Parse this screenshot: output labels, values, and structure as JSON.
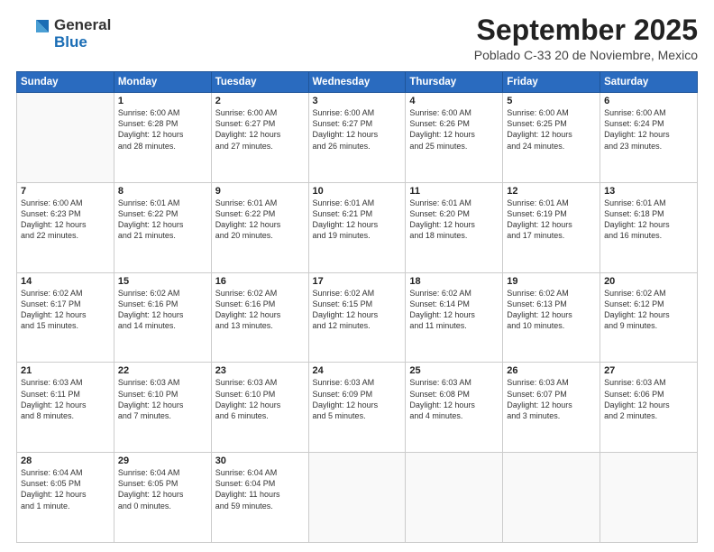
{
  "header": {
    "logo": {
      "line1": "General",
      "line2": "Blue"
    },
    "title": "September 2025",
    "location": "Poblado C-33 20 de Noviembre, Mexico"
  },
  "calendar": {
    "days_of_week": [
      "Sunday",
      "Monday",
      "Tuesday",
      "Wednesday",
      "Thursday",
      "Friday",
      "Saturday"
    ],
    "weeks": [
      [
        {
          "day": "",
          "info": ""
        },
        {
          "day": "1",
          "info": "Sunrise: 6:00 AM\nSunset: 6:28 PM\nDaylight: 12 hours\nand 28 minutes."
        },
        {
          "day": "2",
          "info": "Sunrise: 6:00 AM\nSunset: 6:27 PM\nDaylight: 12 hours\nand 27 minutes."
        },
        {
          "day": "3",
          "info": "Sunrise: 6:00 AM\nSunset: 6:27 PM\nDaylight: 12 hours\nand 26 minutes."
        },
        {
          "day": "4",
          "info": "Sunrise: 6:00 AM\nSunset: 6:26 PM\nDaylight: 12 hours\nand 25 minutes."
        },
        {
          "day": "5",
          "info": "Sunrise: 6:00 AM\nSunset: 6:25 PM\nDaylight: 12 hours\nand 24 minutes."
        },
        {
          "day": "6",
          "info": "Sunrise: 6:00 AM\nSunset: 6:24 PM\nDaylight: 12 hours\nand 23 minutes."
        }
      ],
      [
        {
          "day": "7",
          "info": "Sunrise: 6:00 AM\nSunset: 6:23 PM\nDaylight: 12 hours\nand 22 minutes."
        },
        {
          "day": "8",
          "info": "Sunrise: 6:01 AM\nSunset: 6:22 PM\nDaylight: 12 hours\nand 21 minutes."
        },
        {
          "day": "9",
          "info": "Sunrise: 6:01 AM\nSunset: 6:22 PM\nDaylight: 12 hours\nand 20 minutes."
        },
        {
          "day": "10",
          "info": "Sunrise: 6:01 AM\nSunset: 6:21 PM\nDaylight: 12 hours\nand 19 minutes."
        },
        {
          "day": "11",
          "info": "Sunrise: 6:01 AM\nSunset: 6:20 PM\nDaylight: 12 hours\nand 18 minutes."
        },
        {
          "day": "12",
          "info": "Sunrise: 6:01 AM\nSunset: 6:19 PM\nDaylight: 12 hours\nand 17 minutes."
        },
        {
          "day": "13",
          "info": "Sunrise: 6:01 AM\nSunset: 6:18 PM\nDaylight: 12 hours\nand 16 minutes."
        }
      ],
      [
        {
          "day": "14",
          "info": "Sunrise: 6:02 AM\nSunset: 6:17 PM\nDaylight: 12 hours\nand 15 minutes."
        },
        {
          "day": "15",
          "info": "Sunrise: 6:02 AM\nSunset: 6:16 PM\nDaylight: 12 hours\nand 14 minutes."
        },
        {
          "day": "16",
          "info": "Sunrise: 6:02 AM\nSunset: 6:16 PM\nDaylight: 12 hours\nand 13 minutes."
        },
        {
          "day": "17",
          "info": "Sunrise: 6:02 AM\nSunset: 6:15 PM\nDaylight: 12 hours\nand 12 minutes."
        },
        {
          "day": "18",
          "info": "Sunrise: 6:02 AM\nSunset: 6:14 PM\nDaylight: 12 hours\nand 11 minutes."
        },
        {
          "day": "19",
          "info": "Sunrise: 6:02 AM\nSunset: 6:13 PM\nDaylight: 12 hours\nand 10 minutes."
        },
        {
          "day": "20",
          "info": "Sunrise: 6:02 AM\nSunset: 6:12 PM\nDaylight: 12 hours\nand 9 minutes."
        }
      ],
      [
        {
          "day": "21",
          "info": "Sunrise: 6:03 AM\nSunset: 6:11 PM\nDaylight: 12 hours\nand 8 minutes."
        },
        {
          "day": "22",
          "info": "Sunrise: 6:03 AM\nSunset: 6:10 PM\nDaylight: 12 hours\nand 7 minutes."
        },
        {
          "day": "23",
          "info": "Sunrise: 6:03 AM\nSunset: 6:10 PM\nDaylight: 12 hours\nand 6 minutes."
        },
        {
          "day": "24",
          "info": "Sunrise: 6:03 AM\nSunset: 6:09 PM\nDaylight: 12 hours\nand 5 minutes."
        },
        {
          "day": "25",
          "info": "Sunrise: 6:03 AM\nSunset: 6:08 PM\nDaylight: 12 hours\nand 4 minutes."
        },
        {
          "day": "26",
          "info": "Sunrise: 6:03 AM\nSunset: 6:07 PM\nDaylight: 12 hours\nand 3 minutes."
        },
        {
          "day": "27",
          "info": "Sunrise: 6:03 AM\nSunset: 6:06 PM\nDaylight: 12 hours\nand 2 minutes."
        }
      ],
      [
        {
          "day": "28",
          "info": "Sunrise: 6:04 AM\nSunset: 6:05 PM\nDaylight: 12 hours\nand 1 minute."
        },
        {
          "day": "29",
          "info": "Sunrise: 6:04 AM\nSunset: 6:05 PM\nDaylight: 12 hours\nand 0 minutes."
        },
        {
          "day": "30",
          "info": "Sunrise: 6:04 AM\nSunset: 6:04 PM\nDaylight: 11 hours\nand 59 minutes."
        },
        {
          "day": "",
          "info": ""
        },
        {
          "day": "",
          "info": ""
        },
        {
          "day": "",
          "info": ""
        },
        {
          "day": "",
          "info": ""
        }
      ]
    ]
  }
}
